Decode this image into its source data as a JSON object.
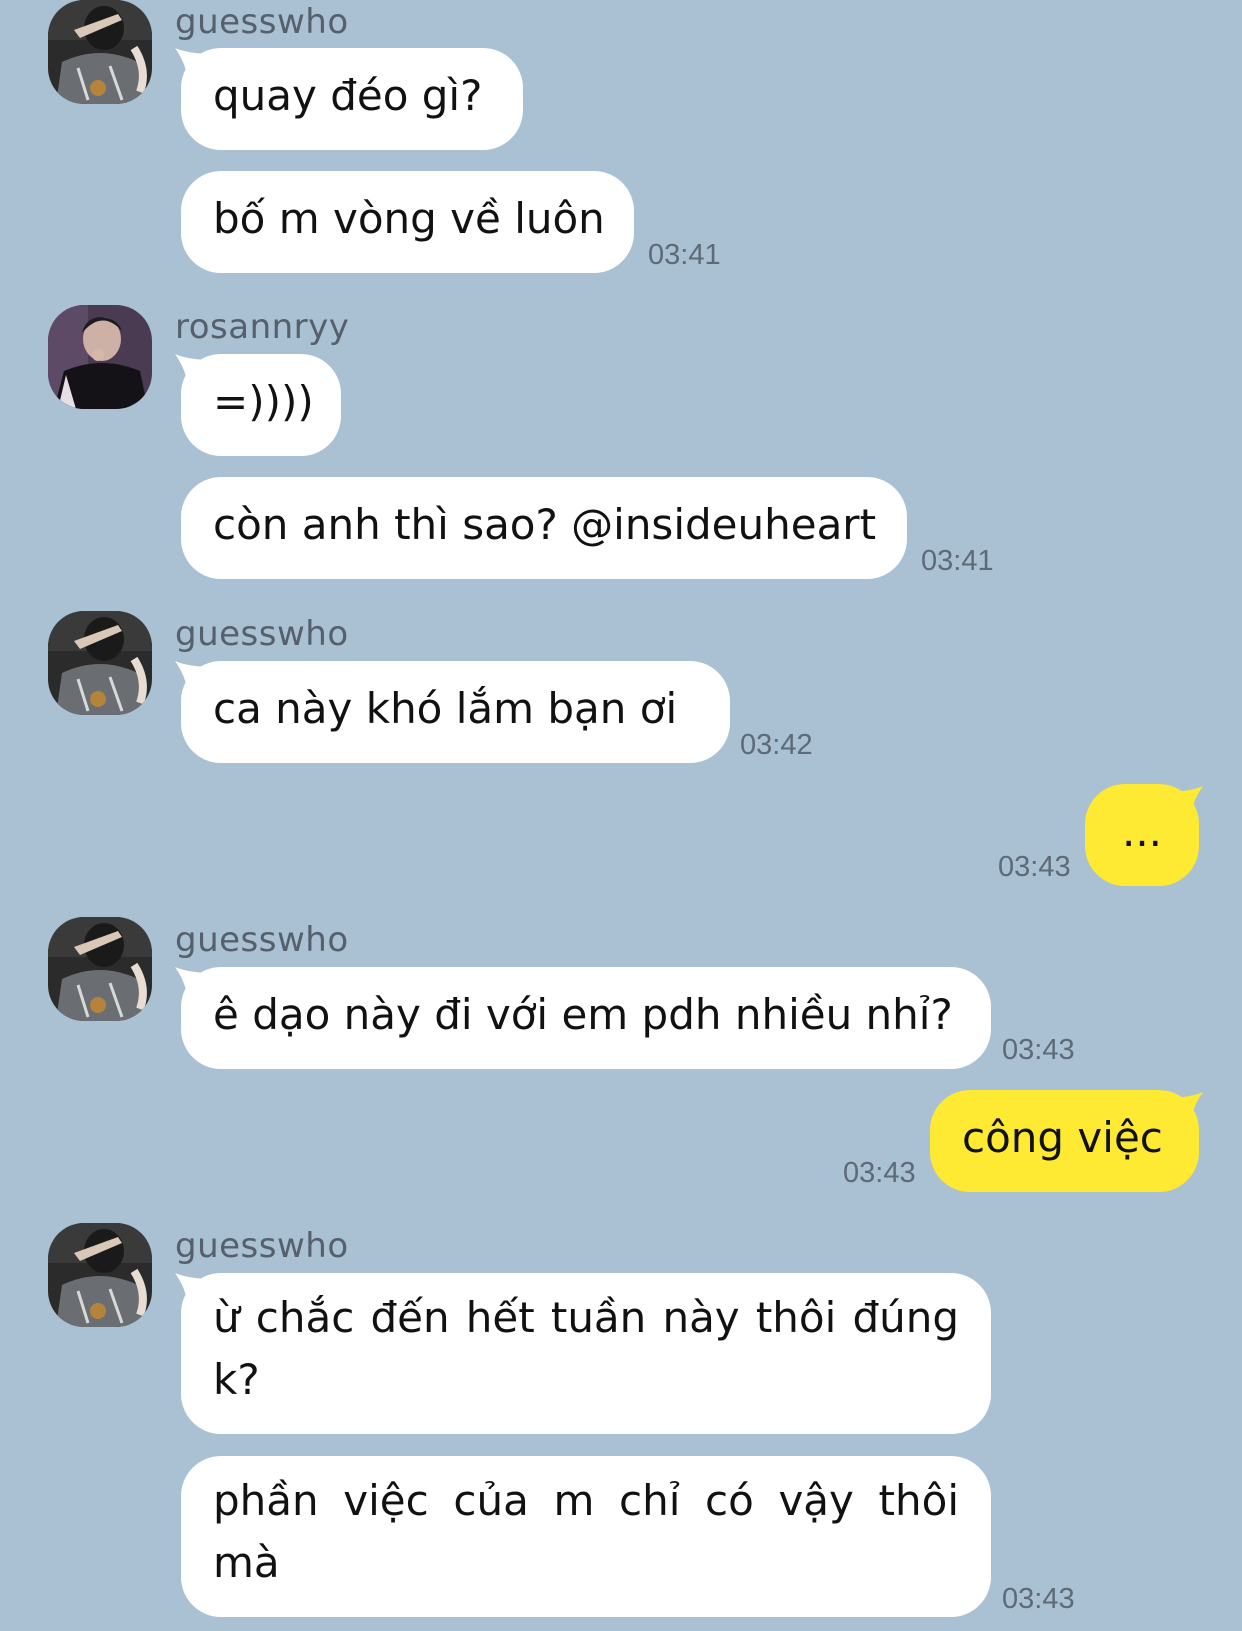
{
  "colors": {
    "background": "#aac0d3",
    "incoming_bubble": "#ffffff",
    "outgoing_bubble": "#fee933",
    "meta_text": "#5d6a78"
  },
  "messages": [
    {
      "sender": "guesswho",
      "avatar": "user-avatar-icon",
      "bubbles": [
        "quay đéo gì?",
        "bố m vòng về luôn"
      ],
      "time": "03:41"
    },
    {
      "sender": "rosannryy",
      "avatar": "user-avatar-icon",
      "bubbles": [
        "=))))",
        "còn anh thì sao? @insideuheart"
      ],
      "time": "03:41"
    },
    {
      "sender": "guesswho",
      "avatar": "user-avatar-icon",
      "bubbles": [
        "ca này khó lắm bạn ơi"
      ],
      "time": "03:42"
    },
    {
      "sender": "me",
      "bubbles": [
        "..."
      ],
      "time": "03:43"
    },
    {
      "sender": "guesswho",
      "avatar": "user-avatar-icon",
      "bubbles": [
        "ê dạo này đi với em pdh nhiều nhỉ?"
      ],
      "time": "03:43"
    },
    {
      "sender": "me",
      "bubbles": [
        "công việc"
      ],
      "time": "03:43"
    },
    {
      "sender": "guesswho",
      "avatar": "user-avatar-icon",
      "bubbles": [
        "ừ chắc đến hết tuần này thôi đúng k?",
        "phần việc của m chỉ có vậy thôi mà"
      ],
      "time": "03:43"
    }
  ]
}
